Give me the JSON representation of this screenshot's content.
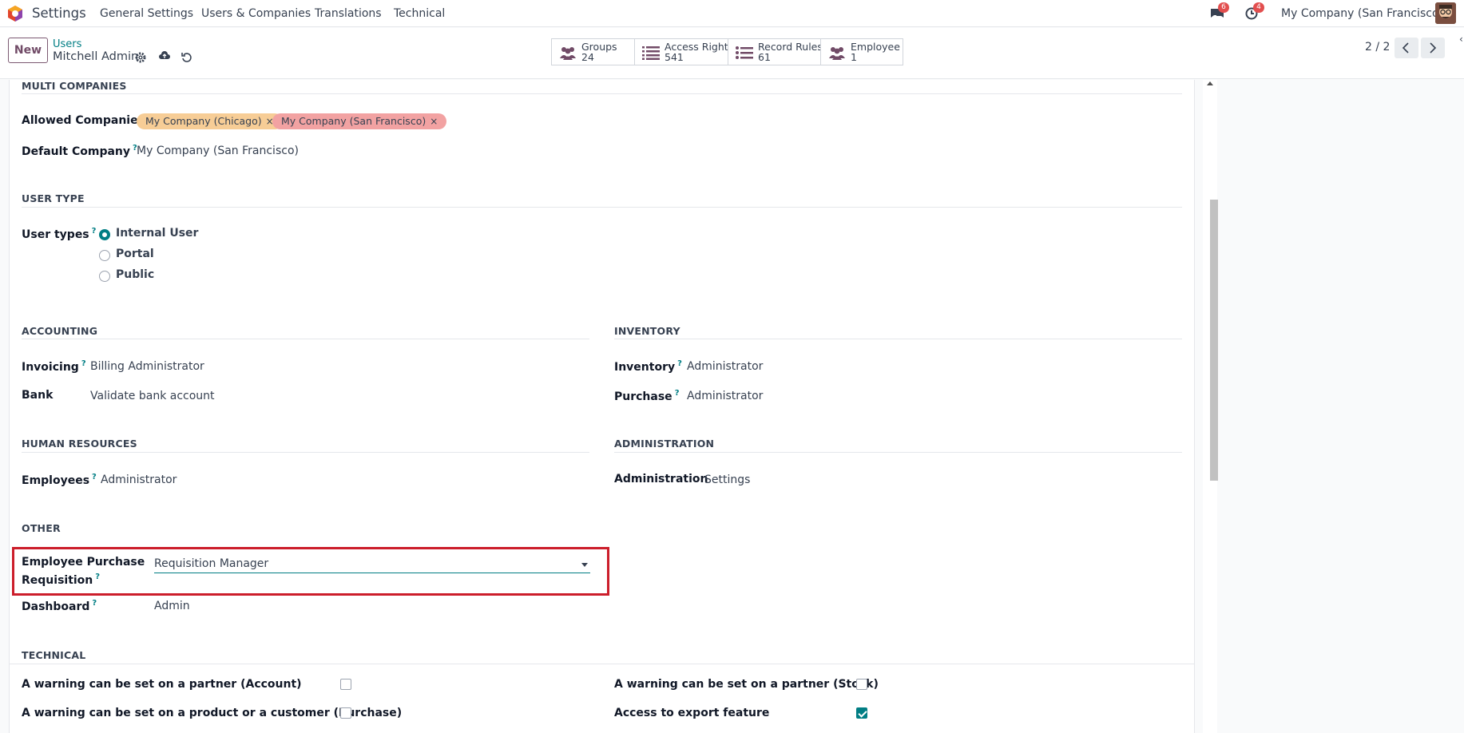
{
  "navbar": {
    "app_name": "Settings",
    "menus": [
      "General Settings",
      "Users & Companies",
      "Translations",
      "Technical"
    ],
    "messages_count": "6",
    "activities_count": "4",
    "company": "My Company (San Francisco)"
  },
  "control_panel": {
    "new_label": "New",
    "breadcrumb_parent": "Users",
    "breadcrumb_current": "Mitchell Admin",
    "smart_buttons": [
      {
        "label": "Groups",
        "count": "24"
      },
      {
        "label": "Access Rights",
        "count": "541"
      },
      {
        "label": "Record Rules",
        "count": "61"
      },
      {
        "label": "Employee",
        "count": "1"
      }
    ],
    "pager": "2 / 2"
  },
  "form": {
    "multi_companies": {
      "title": "MULTI COMPANIES",
      "allowed_label": "Allowed Companies",
      "allowed_tags": [
        {
          "name": "My Company (Chicago)",
          "color": "#f7cd96"
        },
        {
          "name": "My Company (San Francisco)",
          "color": "#f2a2a2"
        }
      ],
      "default_label": "Default Company",
      "default_help": "?",
      "default_value": "My Company (San Francisco)"
    },
    "user_type": {
      "title": "USER TYPE",
      "label": "User types",
      "help": "?",
      "options": [
        "Internal User",
        "Portal",
        "Public"
      ],
      "selected": "Internal User"
    },
    "accounting": {
      "title": "ACCOUNTING",
      "invoicing_label": "Invoicing",
      "invoicing_value": "Billing Administrator",
      "bank_label": "Bank",
      "bank_value": "Validate bank account"
    },
    "inventory": {
      "title": "INVENTORY",
      "inventory_label": "Inventory",
      "inventory_value": "Administrator",
      "purchase_label": "Purchase",
      "purchase_value": "Administrator"
    },
    "human_resources": {
      "title": "HUMAN RESOURCES",
      "employees_label": "Employees",
      "employees_value": "Administrator"
    },
    "administration": {
      "title": "ADMINISTRATION",
      "label": "Administration",
      "value": "Settings"
    },
    "other": {
      "title": "OTHER",
      "epr_label_line1": "Employee Purchase",
      "epr_label_line2": "Requisition",
      "epr_value": "Requisition Manager",
      "dashboard_label": "Dashboard",
      "dashboard_value": "Admin"
    },
    "technical": {
      "title": "TECHNICAL",
      "warn_account": "A warning can be set on a partner (Account)",
      "warn_purchase": "A warning can be set on a product or a customer (Purchase)",
      "warn_stock": "A warning can be set on a partner (Stock)",
      "export": "Access to export feature",
      "warn_account_checked": false,
      "warn_purchase_checked": false,
      "warn_stock_checked": false,
      "export_checked": true
    }
  },
  "colors": {
    "accent": "#017e84",
    "brand": "#714b67",
    "highlight": "#cc1e2b"
  }
}
